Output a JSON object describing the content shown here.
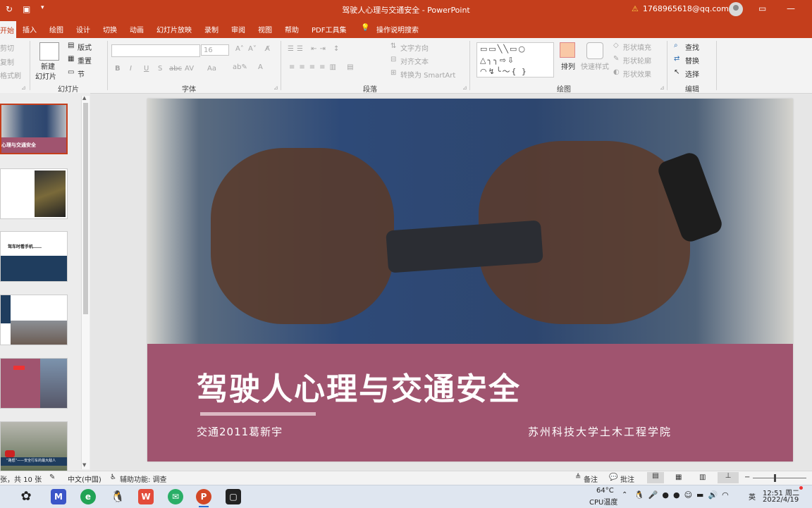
{
  "window": {
    "title": "驾驶人心理与交通安全 - PowerPoint",
    "account": "1768965618@qq.com",
    "warning_icon": "warning-icon",
    "controls": [
      "minimize-icon",
      "restore-icon",
      "close-icon"
    ]
  },
  "quick_access": {
    "redo_icon": "redo-icon",
    "save_icon": "save-icon",
    "more_icon": "chevron-down-icon"
  },
  "tabs": [
    "开始",
    "插入",
    "绘图",
    "设计",
    "切换",
    "动画",
    "幻灯片放映",
    "录制",
    "审阅",
    "视图",
    "帮助",
    "PDF工具集",
    "操作说明搜索"
  ],
  "ribbon": {
    "clipboard": {
      "cut": "剪切",
      "copy": "复制",
      "format": "格式刷"
    },
    "slides": {
      "new_slide": "新建",
      "new_slide2": "幻灯片",
      "layout": "版式",
      "reset": "重置",
      "section": "节",
      "group_label": "幻灯片"
    },
    "font": {
      "size": "16",
      "bold": "B",
      "italic": "I",
      "underline": "U",
      "shadow": "S",
      "strike": "abc",
      "spacing": "AV",
      "case": "Aa",
      "color": "A",
      "group_label": "字体"
    },
    "paragraph": {
      "text_direction": "文字方向",
      "align_text": "对齐文本",
      "smartart": "转换为 SmartArt",
      "group_label": "段落"
    },
    "drawing": {
      "shape_glyphs": "▭▭╲╲▭○ △╮╮⇨⇩ ◠↯╰〜{ }",
      "arrange": "排列",
      "quick_styles": "快速样式",
      "fill": "形状填充",
      "outline": "形状轮廓",
      "effects": "形状效果",
      "group_label": "绘图"
    },
    "editing": {
      "find": "查找",
      "replace": "替换",
      "select": "选择",
      "group_label": "编辑"
    }
  },
  "slide": {
    "title": "驾驶人心理与交通安全",
    "author": "交通2011葛新宇",
    "school": "苏州科技大学土木工程学院",
    "band_color": "#a0546f"
  },
  "thumbnails": {
    "1": {
      "title": "心理与交通安全"
    },
    "3": {
      "title": "驾车时看手机……"
    },
    "6": {
      "title": "“路怒”——安全行车的最大敌人"
    }
  },
  "status": {
    "slide_count": "张，共 10 张",
    "language": "中文(中国)",
    "accessibility": "辅助功能: 调查",
    "notes": "备注",
    "comments": "批注"
  },
  "taskbar": {
    "temp": "64°C",
    "temp_label": "CPU温度",
    "ime": "英",
    "time": "12:51 周二",
    "date": "2022/4/19"
  }
}
